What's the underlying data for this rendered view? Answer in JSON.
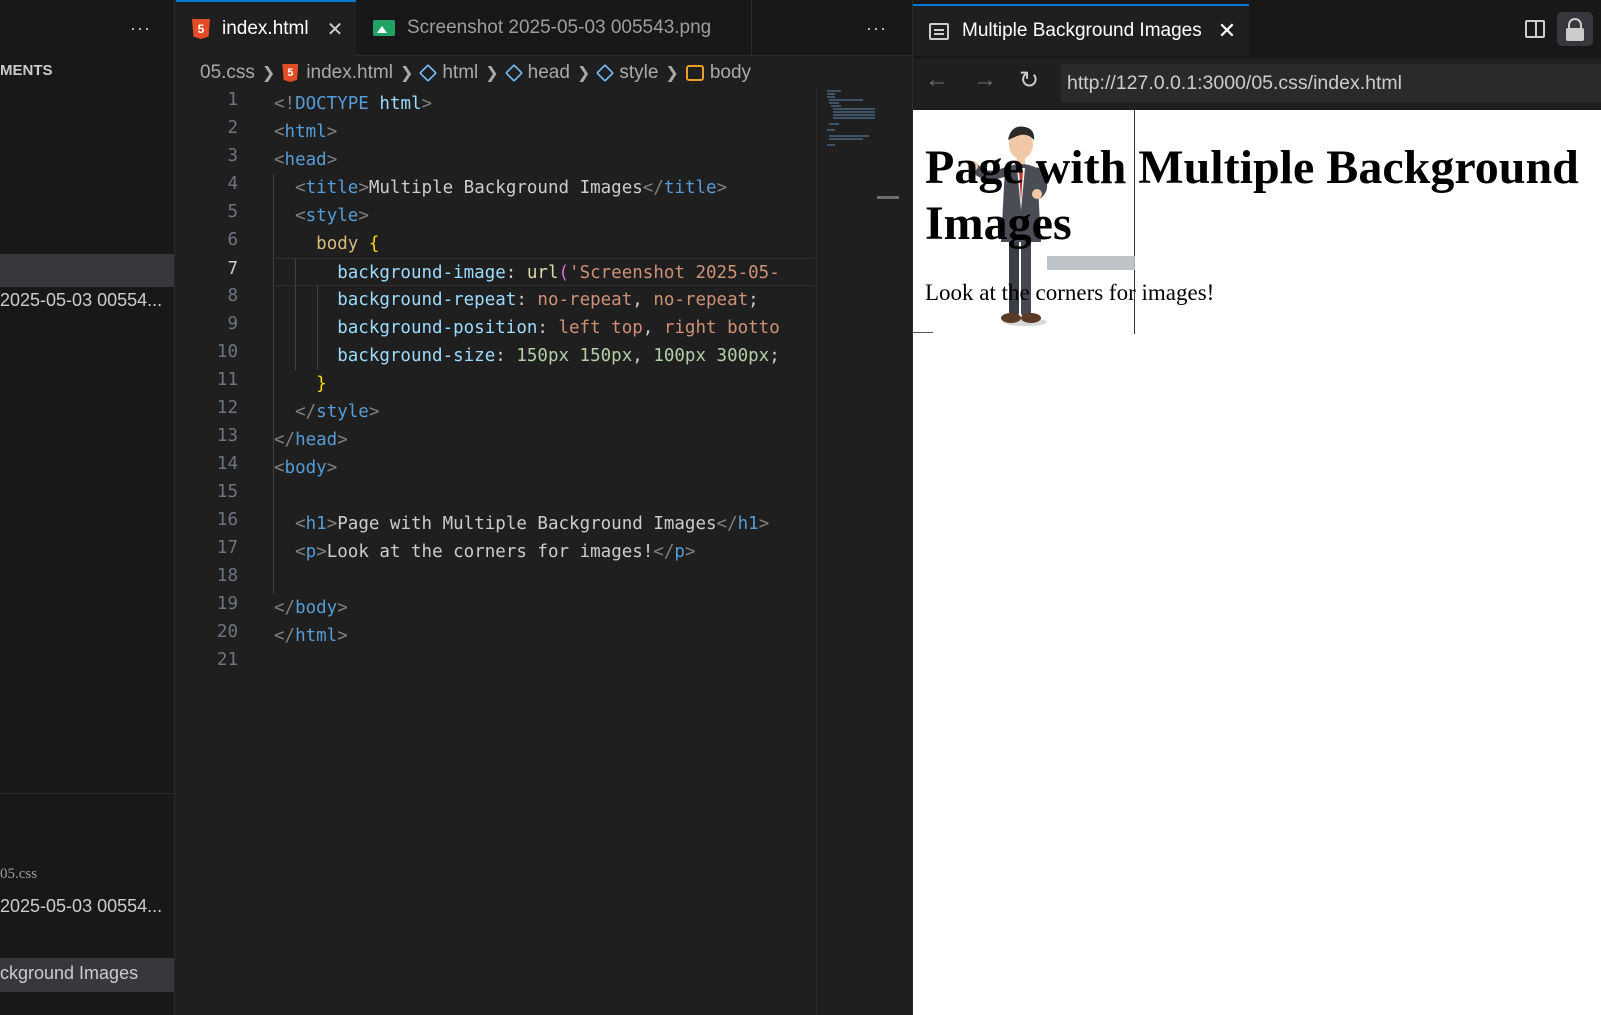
{
  "sidebar": {
    "more": "···",
    "section_title": "MENTS",
    "items": [
      {
        "label": "2025-05-03 00554..."
      },
      {
        "label": "05.css"
      },
      {
        "label": "2025-05-03 00554..."
      },
      {
        "label": "ckground Images"
      }
    ]
  },
  "editor": {
    "tabs": [
      {
        "label": "index.html",
        "icon": "html5-icon",
        "close": "✕"
      },
      {
        "label": "Screenshot 2025-05-03 005543.png",
        "icon": "image-icon"
      }
    ],
    "more": "···",
    "breadcrumb": [
      "05.css",
      "index.html",
      "html",
      "head",
      "style",
      "body"
    ],
    "current_line": 7,
    "lines": [
      {
        "n": "1"
      },
      {
        "n": "2"
      },
      {
        "n": "3"
      },
      {
        "n": "4"
      },
      {
        "n": "5"
      },
      {
        "n": "6"
      },
      {
        "n": "7"
      },
      {
        "n": "8"
      },
      {
        "n": "9"
      },
      {
        "n": "10"
      },
      {
        "n": "11"
      },
      {
        "n": "12"
      },
      {
        "n": "13"
      },
      {
        "n": "14"
      },
      {
        "n": "15"
      },
      {
        "n": "16"
      },
      {
        "n": "17"
      },
      {
        "n": "18"
      },
      {
        "n": "19"
      },
      {
        "n": "20"
      },
      {
        "n": "21"
      }
    ],
    "code": {
      "doctype_open": "<!",
      "doctype_kw": "DOCTYPE",
      "doctype_html": "html",
      "lt": "<",
      "gt": ">",
      "lt_slash": "</",
      "tag_html": "html",
      "tag_head": "head",
      "tag_title": "title",
      "title_text": "Multiple Background Images",
      "tag_style": "style",
      "selector": "body",
      "brace_open": "{",
      "brace_close": "}",
      "prop_image": "background-image",
      "fn_url": "url",
      "paren": "(",
      "str_image": "'Screenshot 2025-05-",
      "prop_repeat": "background-repeat",
      "val_repeat_1": "no-repeat",
      "val_repeat_2": "no-repeat",
      "prop_position": "background-position",
      "val_pos_1": "left top",
      "val_pos_2": "right botto",
      "prop_size": "background-size",
      "val_size_1": "150px 150px",
      "val_size_2": "100px 300px",
      "colon": ": ",
      "comma": ", ",
      "semicolon": ";",
      "tag_body": "body",
      "tag_h1": "h1",
      "h1_text": "Page with Multiple Background Images",
      "tag_p": "p",
      "p_text": "Look at the corners for images!"
    }
  },
  "browser": {
    "tab_title": "Multiple Background Images",
    "tab_close": "✕",
    "back": "←",
    "forward": "→",
    "reload": "↻",
    "url": "http://127.0.0.1:3000/05.css/index.html",
    "page": {
      "h1": "Page with Multiple Background Images",
      "p": "Look at the corners for images!"
    }
  },
  "colors": {
    "accent": "#0078d4",
    "tag": "#569cd6",
    "property": "#9cdcfe",
    "string": "#ce9178",
    "number": "#b5cea8",
    "html5": "#e34c26"
  }
}
